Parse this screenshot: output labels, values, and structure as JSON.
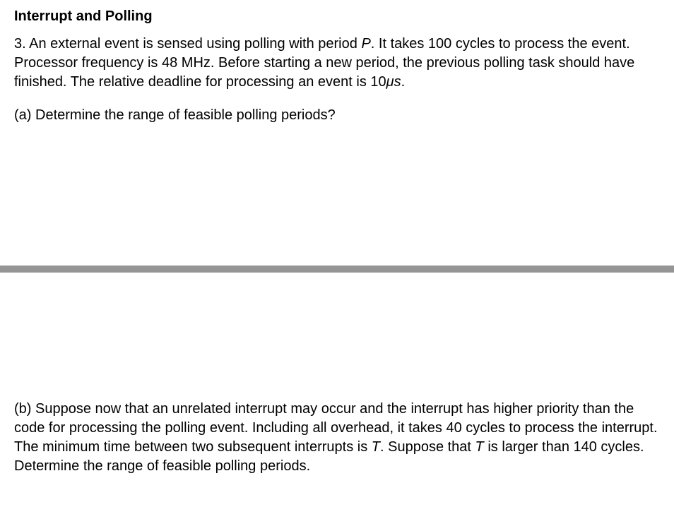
{
  "title": "Interrupt and Polling",
  "question_number": "3.",
  "question_text_1": "An external event is sensed using polling with period ",
  "question_var_P": "P",
  "question_text_2": ". It takes 100 cycles to process the event. Processor frequency is 48 MHz. Before starting a new period, the previous polling task should have finished. The relative deadline for processing an event is 10",
  "question_unit": "μs",
  "question_text_3": ".",
  "part_a_label": "(a)",
  "part_a_text": "Determine the range of feasible polling periods?",
  "part_b_label": "(b)",
  "part_b_text_1": "Suppose now that an unrelated interrupt may occur and the interrupt has higher priority than the code for processing the polling event. Including all overhead, it takes 40 cycles to process the interrupt. The minimum time between two subsequent interrupts is ",
  "part_b_var_T": "T",
  "part_b_text_2": ". Suppose that ",
  "part_b_var_T2": "T ",
  "part_b_text_3": "is larger than 140 cycles. Determine the range of feasible polling periods."
}
